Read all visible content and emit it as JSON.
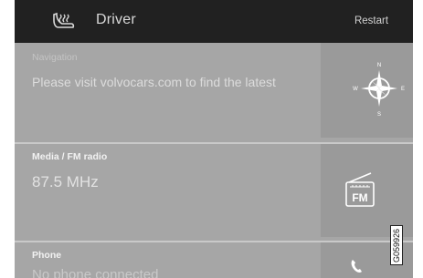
{
  "header": {
    "profile_label": "Driver",
    "restart_label": "Restart"
  },
  "tiles": {
    "navigation": {
      "title": "Navigation",
      "text": "Please visit volvocars.com to find the latest"
    },
    "media": {
      "title": "Media / FM radio",
      "text": "87.5 MHz",
      "badge": "FM"
    },
    "phone": {
      "title": "Phone",
      "text": "No phone connected"
    }
  },
  "compass": {
    "n": "N",
    "s": "S",
    "e": "E",
    "w": "W"
  },
  "figure_code": "G059926"
}
